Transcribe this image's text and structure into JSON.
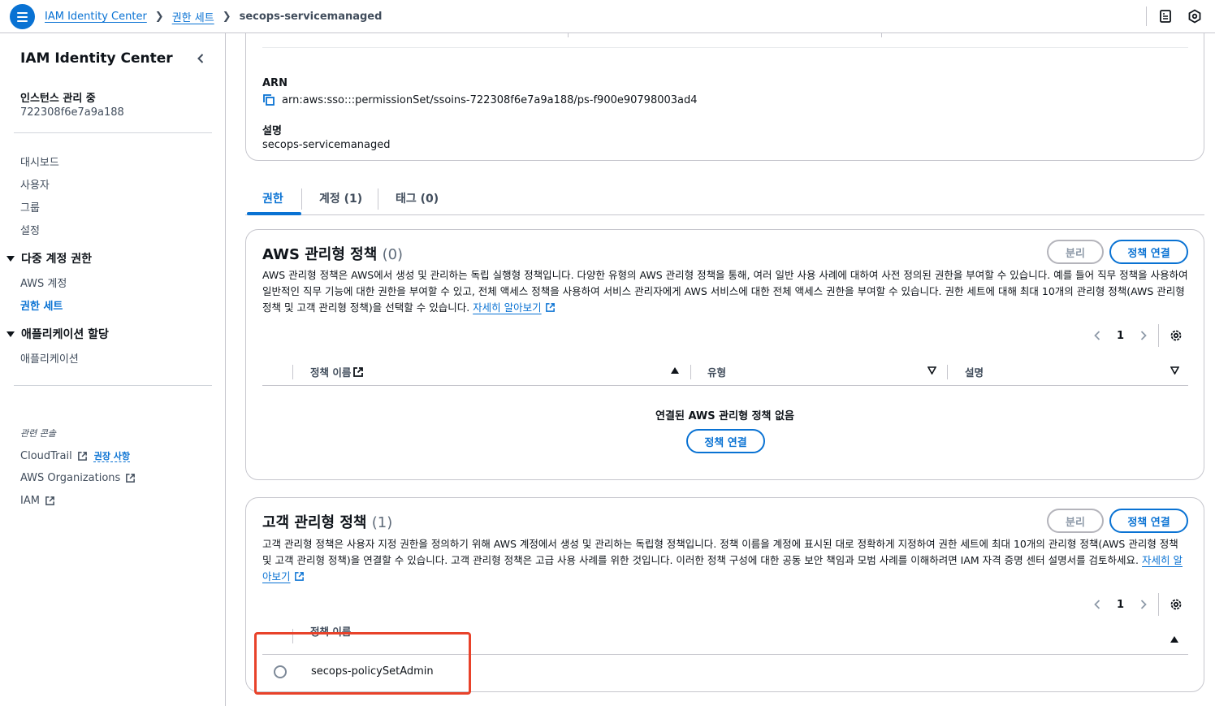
{
  "topbar": {
    "breadcrumbs": [
      "IAM Identity Center",
      "권한 세트",
      "secops-servicemanaged"
    ],
    "icons": [
      "menu-icon",
      "notifications-icon",
      "settings-icon"
    ]
  },
  "sidebar": {
    "title": "IAM Identity Center",
    "instance_label": "인스턴스 관리 중",
    "instance_id": "722308f6e7a9a188",
    "items": [
      "대시보드",
      "사용자",
      "그룹",
      "설정"
    ],
    "section1": {
      "title": "다중 계정 권한",
      "items": [
        "AWS 계정",
        "권한 세트"
      ],
      "active": "권한 세트"
    },
    "section2": {
      "title": "애플리케이션 할당",
      "items": [
        "애플리케이션"
      ]
    },
    "related_label": "관련 콘솔",
    "related": [
      "CloudTrail",
      "AWS Organizations",
      "IAM"
    ],
    "cloudtrail_badge": "권장 사항"
  },
  "details": {
    "arn_label": "ARN",
    "arn_value": "arn:aws:sso:::permissionSet/ssoins-722308f6e7a9a188/ps-f900e90798003ad4",
    "desc_label": "설명",
    "desc_value": "secops-servicemanaged"
  },
  "tabs": [
    "권한",
    "계정 (1)",
    "태그 (0)"
  ],
  "aws_managed": {
    "title": "AWS 관리형 정책",
    "count": "(0)",
    "detach_label": "분리",
    "attach_label": "정책 연결",
    "description": "AWS 관리형 정책은 AWS에서 생성 및 관리하는 독립 실행형 정책입니다. 다양한 유형의 AWS 관리형 정책을 통해, 여러 일반 사용 사례에 대하여 사전 정의된 권한을 부여할 수 있습니다. 예를 들어 직무 정책을 사용하여 일반적인 직무 기능에 대한 권한을 부여할 수 있고, 전체 액세스 정책을 사용하여 서비스 관리자에게 AWS 서비스에 대한 전체 액세스 권한을 부여할 수 있습니다. 권한 세트에 대해 최대 10개의 관리형 정책(AWS 관리형 정책 및 고객 관리형 정책)을 선택할 수 있습니다.",
    "learn_more": "자세히 알아보기",
    "page": "1",
    "columns": [
      "정책 이름",
      "유형",
      "설명"
    ],
    "empty_message": "연결된 AWS 관리형 정책 없음",
    "empty_attach_label": "정책 연결"
  },
  "customer_managed": {
    "title": "고객 관리형 정책",
    "count": "(1)",
    "detach_label": "분리",
    "attach_label": "정책 연결",
    "description": "고객 관리형 정책은 사용자 지정 권한을 정의하기 위해 AWS 계정에서 생성 및 관리하는 독립형 정책입니다. 정책 이름을 계정에 표시된 대로 정확하게 지정하여 권한 세트에 최대 10개의 관리형 정책(AWS 관리형 정책 및 고객 관리형 정책)을 연결할 수 있습니다. 고객 관리형 정책은 고급 사용 사례를 위한 것입니다. 이러한 정책 구성에 대한 공동 보안 책임과 모범 사례를 이해하려면 IAM 자격 증명 센터 설명서를 검토하세요.",
    "learn_more": "자세히 알아보기",
    "page": "1",
    "columns": [
      "정책 이름"
    ],
    "rows": [
      "secops-policySetAdmin"
    ]
  },
  "colors": {
    "accent": "#0972d3",
    "highlight": "#e8422a"
  }
}
